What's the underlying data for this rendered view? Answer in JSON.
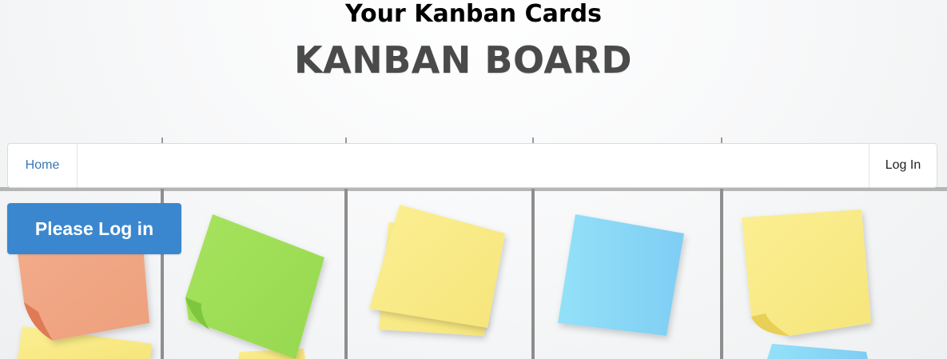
{
  "page": {
    "title": "Your Kanban Cards",
    "board_title": "KANBAN BOARD"
  },
  "navbar": {
    "home_label": "Home",
    "login_label": "Log In"
  },
  "login_prompt": {
    "label": "Please Log in"
  },
  "colors": {
    "accent": "#3a87d0",
    "link": "#3a76b5",
    "note_orange": "#f0a784",
    "note_green": "#a4e05c",
    "note_yellow": "#faec8a",
    "note_blue": "#8fdcf6"
  }
}
